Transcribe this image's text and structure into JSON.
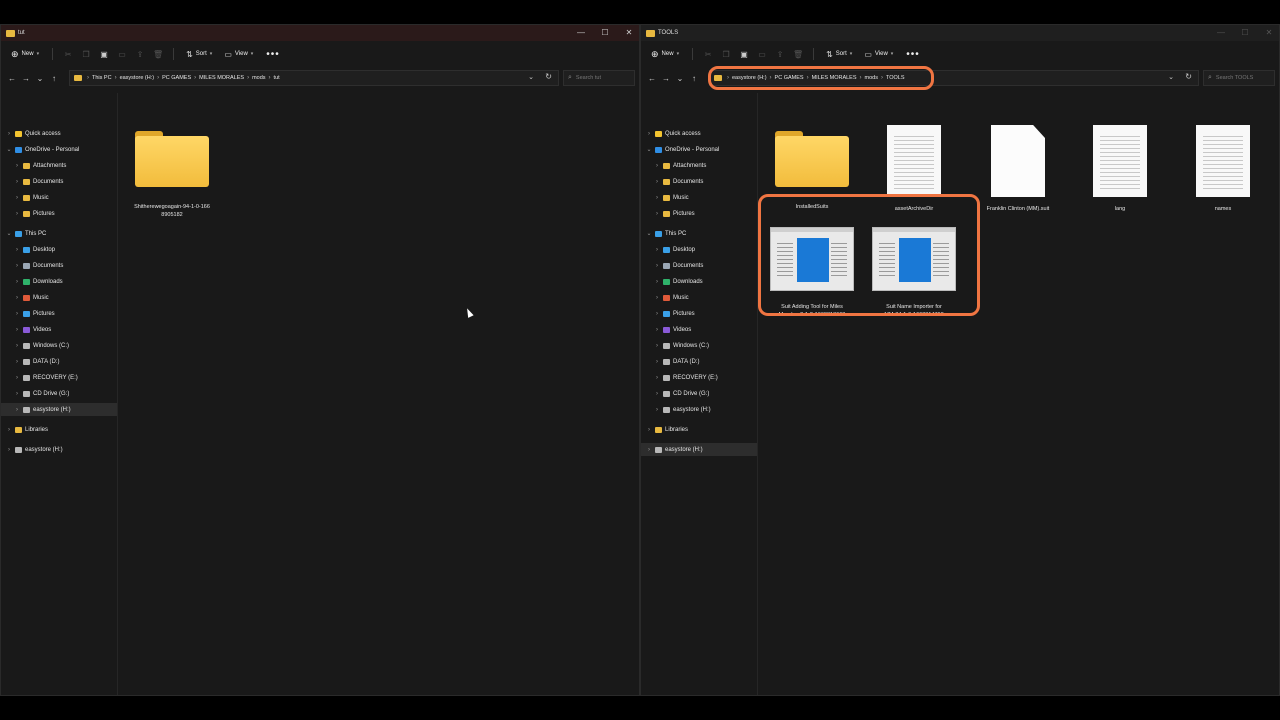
{
  "left_window": {
    "title": "tut",
    "toolbar": {
      "new": "New",
      "sort": "Sort",
      "view": "View"
    },
    "breadcrumb": [
      "This PC",
      "easystore (H:)",
      "PC GAMES",
      "MILES MORALES",
      "mods",
      "tut"
    ],
    "search_placeholder": "Search tut",
    "sidebar": [
      {
        "label": "Quick access",
        "icon": "star-icon"
      },
      {
        "label": "OneDrive - Personal",
        "icon": "cloud-icon"
      },
      {
        "label": "Attachments",
        "icon": "folder-icon"
      },
      {
        "label": "Documents",
        "icon": "folder-icon"
      },
      {
        "label": "Music",
        "icon": "folder-icon"
      },
      {
        "label": "Pictures",
        "icon": "folder-icon"
      },
      {
        "label": "This PC",
        "icon": "pc-icon"
      },
      {
        "label": "Desktop",
        "icon": "desktop-icon"
      },
      {
        "label": "Documents",
        "icon": "documents-icon"
      },
      {
        "label": "Downloads",
        "icon": "download-icon"
      },
      {
        "label": "Music",
        "icon": "music-icon"
      },
      {
        "label": "Pictures",
        "icon": "pictures-icon"
      },
      {
        "label": "Videos",
        "icon": "videos-icon"
      },
      {
        "label": "Windows (C:)",
        "icon": "drive-icon"
      },
      {
        "label": "DATA (D:)",
        "icon": "drive-icon"
      },
      {
        "label": "RECOVERY (E:)",
        "icon": "drive-icon"
      },
      {
        "label": "CD Drive (G:)",
        "icon": "drive-icon"
      },
      {
        "label": "easystore (H:)",
        "icon": "drive-icon"
      },
      {
        "label": "Libraries",
        "icon": "folder-icon"
      },
      {
        "label": "easystore (H:)",
        "icon": "drive-icon"
      }
    ],
    "files": [
      {
        "name": "Shitherewegoagain-94-1-0-166\n8905182",
        "type": "folder"
      }
    ]
  },
  "right_window": {
    "title": "TOOLS",
    "toolbar": {
      "new": "New",
      "sort": "Sort",
      "view": "View"
    },
    "breadcrumb": [
      "easystore (H:)",
      "PC GAMES",
      "MILES MORALES",
      "mods",
      "TOOLS"
    ],
    "search_placeholder": "Search TOOLS",
    "sidebar": [
      {
        "label": "Quick access",
        "icon": "star-icon"
      },
      {
        "label": "OneDrive - Personal",
        "icon": "cloud-icon"
      },
      {
        "label": "Attachments",
        "icon": "folder-icon"
      },
      {
        "label": "Documents",
        "icon": "folder-icon"
      },
      {
        "label": "Music",
        "icon": "folder-icon"
      },
      {
        "label": "Pictures",
        "icon": "folder-icon"
      },
      {
        "label": "This PC",
        "icon": "pc-icon"
      },
      {
        "label": "Desktop",
        "icon": "desktop-icon"
      },
      {
        "label": "Documents",
        "icon": "documents-icon"
      },
      {
        "label": "Downloads",
        "icon": "download-icon"
      },
      {
        "label": "Music",
        "icon": "music-icon"
      },
      {
        "label": "Pictures",
        "icon": "pictures-icon"
      },
      {
        "label": "Videos",
        "icon": "videos-icon"
      },
      {
        "label": "Windows (C:)",
        "icon": "drive-icon"
      },
      {
        "label": "DATA (D:)",
        "icon": "drive-icon"
      },
      {
        "label": "RECOVERY (E:)",
        "icon": "drive-icon"
      },
      {
        "label": "CD Drive (G:)",
        "icon": "drive-icon"
      },
      {
        "label": "easystore (H:)",
        "icon": "drive-icon"
      },
      {
        "label": "Libraries",
        "icon": "folder-icon"
      },
      {
        "label": "easystore (H:)",
        "icon": "drive-icon"
      }
    ],
    "files": [
      {
        "name": "InstalledSuits",
        "type": "folder"
      },
      {
        "name": "assetArchiveDir",
        "type": "text-doc"
      },
      {
        "name": "Franklin Clinton (MM).suit",
        "type": "blank-doc"
      },
      {
        "name": "lang",
        "type": "text-doc"
      },
      {
        "name": "names",
        "type": "text-doc"
      },
      {
        "name": "Suit Adding Tool for Miles\nMorales-2-1-2-1668813668",
        "type": "exe"
      },
      {
        "name": "Suit Name Importer for\nMM-34-1-0-1668814768",
        "type": "exe"
      }
    ]
  },
  "colors": {
    "highlight": "#f07542",
    "folder": "#f2bc3c",
    "exe_blue": "#1a79d6"
  }
}
